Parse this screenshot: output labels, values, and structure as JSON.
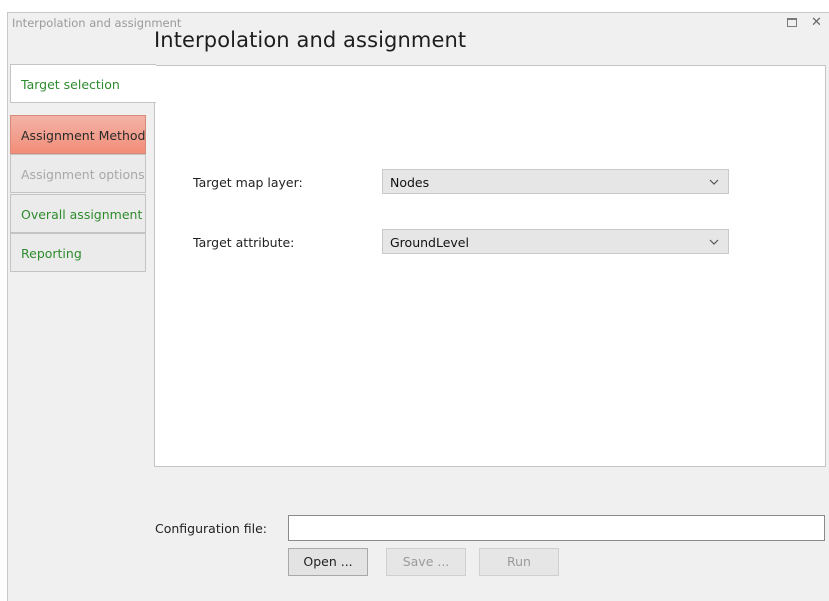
{
  "window": {
    "title": "Interpolation and assignment",
    "heading": "Interpolation and assignment"
  },
  "tabs": [
    {
      "label": "Target selection",
      "state": "active"
    },
    {
      "label": "Assignment Method",
      "state": "highlighted"
    },
    {
      "label": "Assignment options",
      "state": "disabled"
    },
    {
      "label": "Overall assignment",
      "state": "normal"
    },
    {
      "label": "Reporting",
      "state": "normal"
    }
  ],
  "form": {
    "target_map_layer_label": "Target map layer:",
    "target_map_layer_value": "Nodes",
    "target_attribute_label": "Target attribute:",
    "target_attribute_value": "GroundLevel"
  },
  "config": {
    "label": "Configuration file:",
    "value": "",
    "open_label": "Open ...",
    "save_label": "Save ...",
    "run_label": "Run"
  },
  "icons": [
    "maximize-icon",
    "close-icon",
    "chevron-down-icon"
  ],
  "colors": {
    "tab_text_green": "#2e8b2e",
    "method_tab_fill": "#f28e79",
    "disabled_text": "#a8a8a8"
  }
}
